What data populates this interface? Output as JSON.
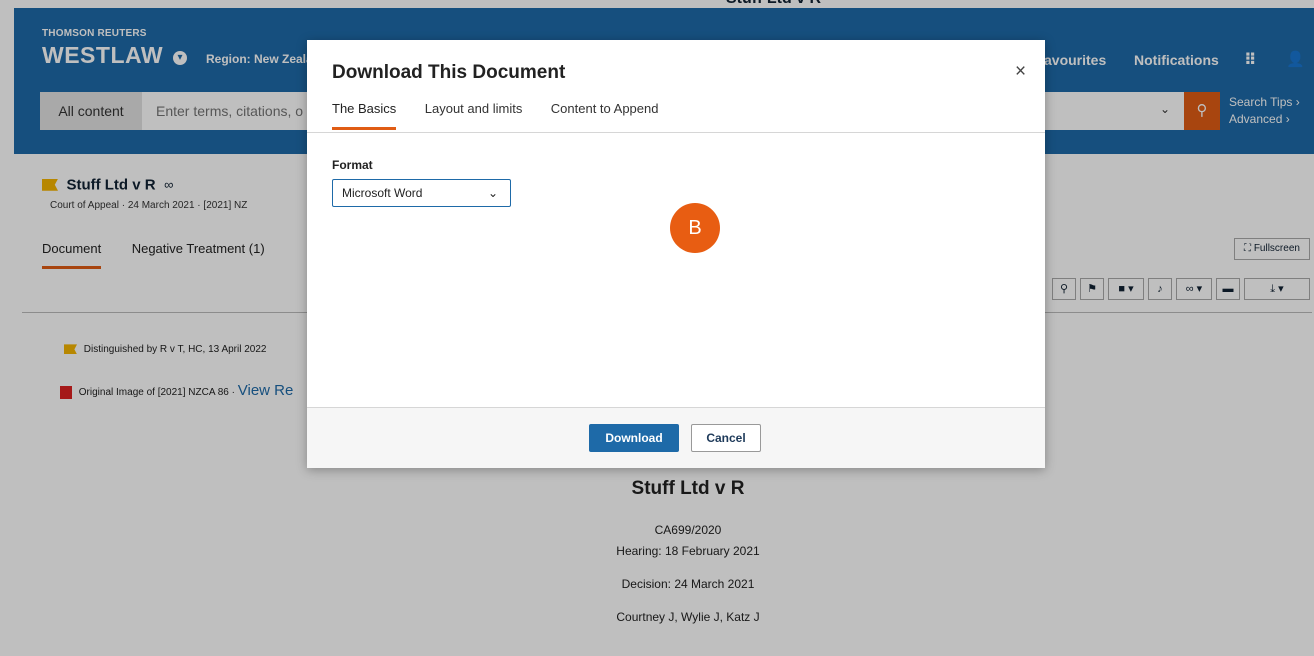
{
  "peek_title": "Stuff Ltd v R",
  "header": {
    "brand_top": "THOMSON REUTERS",
    "brand_main": "WESTLAW",
    "region": "Region: New Zeala",
    "nav_favourites": "avourites",
    "nav_notifications": "Notifications",
    "search": {
      "scope": "All content",
      "placeholder": "Enter terms, citations, o"
    },
    "search_tips": "Search Tips",
    "advanced": "Advanced"
  },
  "document": {
    "title": "Stuff Ltd v R",
    "meta": "Court of Appeal  ·  24 March 2021  ·  [2021] NZ",
    "tabs": [
      {
        "label": "Document",
        "active": true
      },
      {
        "label": "Negative Treatment (1)",
        "active": false
      }
    ],
    "fullscreen": "Fullscreen",
    "negative_treatment": "Distinguished by R v T, HC, 13 April 2022",
    "original_image": "Original Image of [2021] NZCA 86  ·",
    "view_link": "View Re"
  },
  "case": {
    "name": "Stuff Ltd v R",
    "number": "CA699/2020",
    "hearing": "Hearing: 18 February 2021",
    "decision": "Decision: 24 March 2021",
    "judges": "Courtney J, Wylie J, Katz J"
  },
  "modal": {
    "title": "Download This Document",
    "close": "×",
    "tabs": [
      {
        "label": "The Basics",
        "active": true
      },
      {
        "label": "Layout and limits",
        "active": false
      },
      {
        "label": "Content to Append",
        "active": false
      }
    ],
    "format_label": "Format",
    "format_value": "Microsoft Word",
    "badge": "B",
    "download": "Download",
    "cancel": "Cancel"
  },
  "colors": {
    "header_blue": "#1e6aa8",
    "accent_orange": "#e05c14",
    "badge_orange": "#e85d12"
  }
}
